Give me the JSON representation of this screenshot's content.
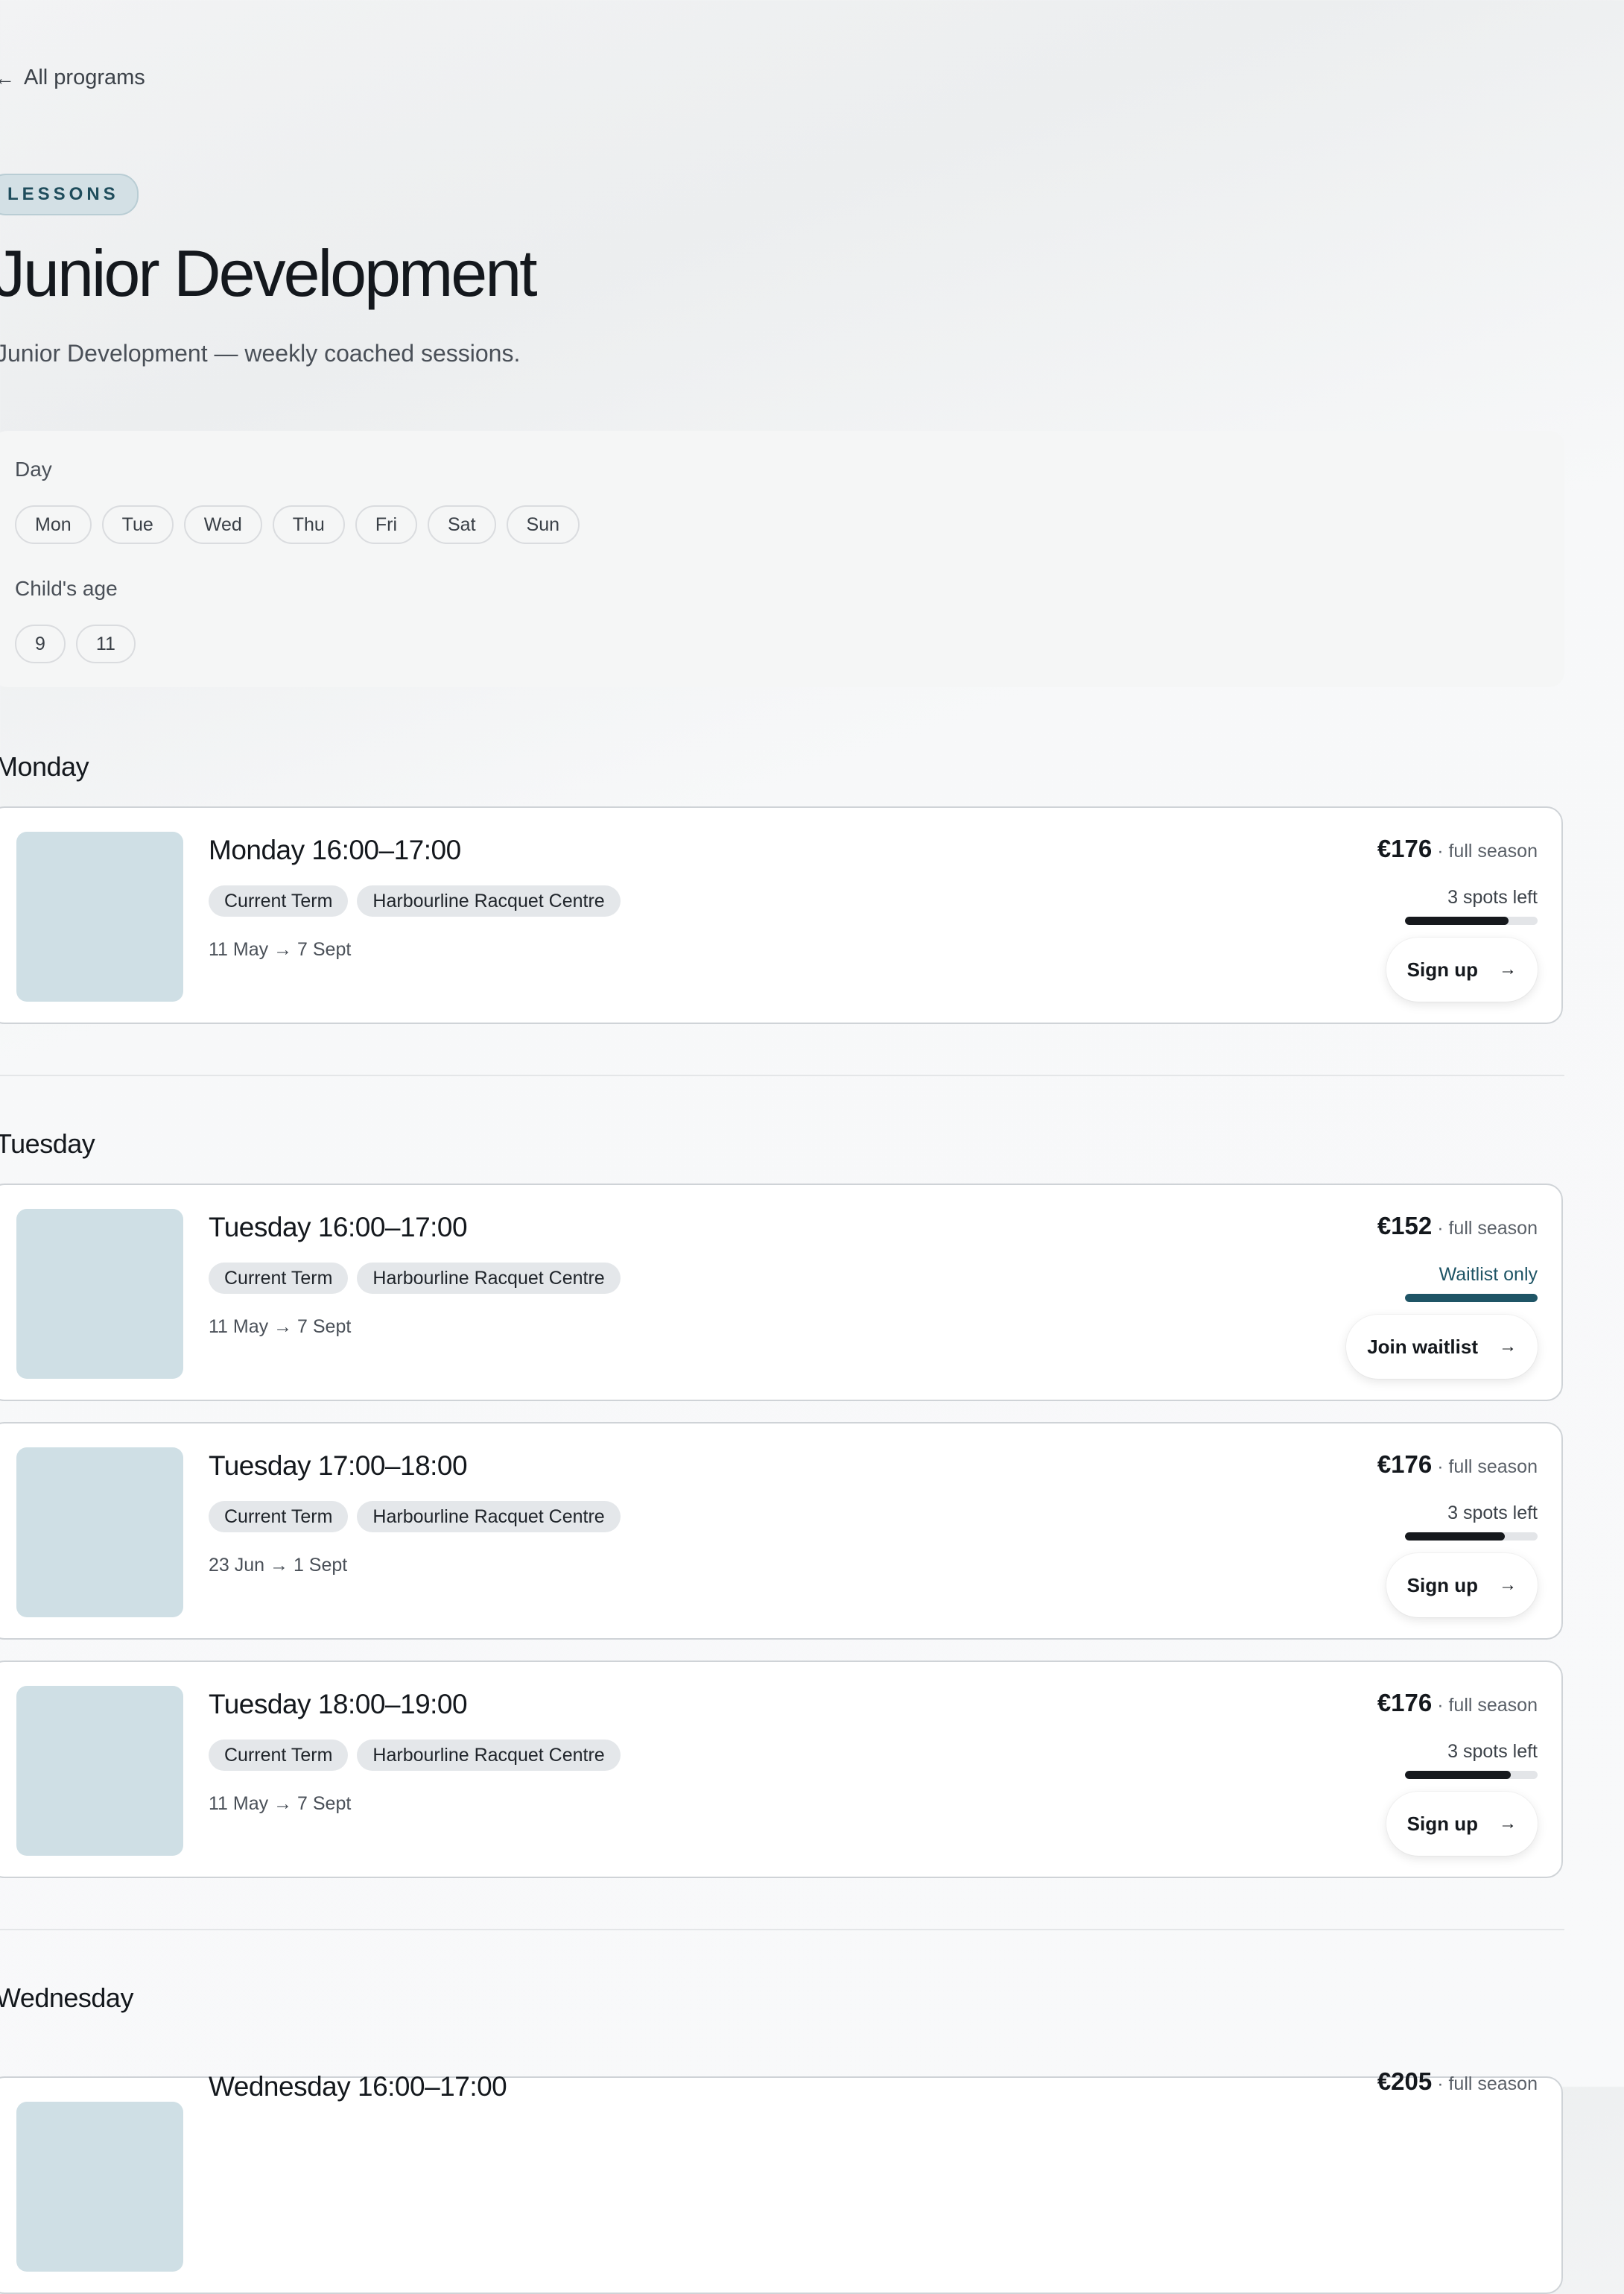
{
  "back_link": {
    "label": "All programs"
  },
  "program": {
    "badge": "LESSONS",
    "title": "Junior Development",
    "subtitle": "Junior Development — weekly coached sessions."
  },
  "filters": {
    "day": {
      "label": "Day",
      "options": [
        "Mon",
        "Tue",
        "Wed",
        "Thu",
        "Fri",
        "Sat",
        "Sun"
      ]
    },
    "age": {
      "label": "Child's age",
      "options": [
        "9",
        "11"
      ]
    }
  },
  "sections": [
    {
      "heading": "Monday",
      "sessions": [
        {
          "title": "Monday 16:00–17:00",
          "tags": [
            "Current Term",
            "Harbourline Racquet Centre"
          ],
          "dates": "11 May → 7 Sept",
          "price": "€176",
          "price_note": "full season",
          "availability": "3 spots left",
          "fill": 0.78,
          "status": "open",
          "button": "Sign up"
        }
      ]
    },
    {
      "heading": "Tuesday",
      "sessions": [
        {
          "title": "Tuesday 16:00–17:00",
          "tags": [
            "Current Term",
            "Harbourline Racquet Centre"
          ],
          "dates": "11 May → 7 Sept",
          "price": "€152",
          "price_note": "full season",
          "availability": "Waitlist only",
          "fill": 1.0,
          "status": "waitlist",
          "button": "Join waitlist"
        },
        {
          "title": "Tuesday 17:00–18:00",
          "tags": [
            "Current Term",
            "Harbourline Racquet Centre"
          ],
          "dates": "23 Jun → 1 Sept",
          "price": "€176",
          "price_note": "full season",
          "availability": "3 spots left",
          "fill": 0.75,
          "status": "open",
          "button": "Sign up"
        },
        {
          "title": "Tuesday 18:00–19:00",
          "tags": [
            "Current Term",
            "Harbourline Racquet Centre"
          ],
          "dates": "11 May → 7 Sept",
          "price": "€176",
          "price_note": "full season",
          "availability": "3 spots left",
          "fill": 0.8,
          "status": "open",
          "button": "Sign up"
        }
      ]
    },
    {
      "heading": "Wednesday",
      "sessions": [
        {
          "title": "Wednesday 16:00–17:00",
          "tags": [],
          "dates": "",
          "price": "€205",
          "price_note": "full season",
          "availability": "",
          "fill": null,
          "status": "open",
          "button": ""
        }
      ]
    }
  ],
  "colors": {
    "accent": "#1f5566",
    "bar_fill": "#16191d",
    "thumb": "#cfdfe5",
    "badge_bg": "#d3e0e5"
  },
  "icons": {
    "back": "arrow-left-icon",
    "button": "arrow-right-icon"
  }
}
